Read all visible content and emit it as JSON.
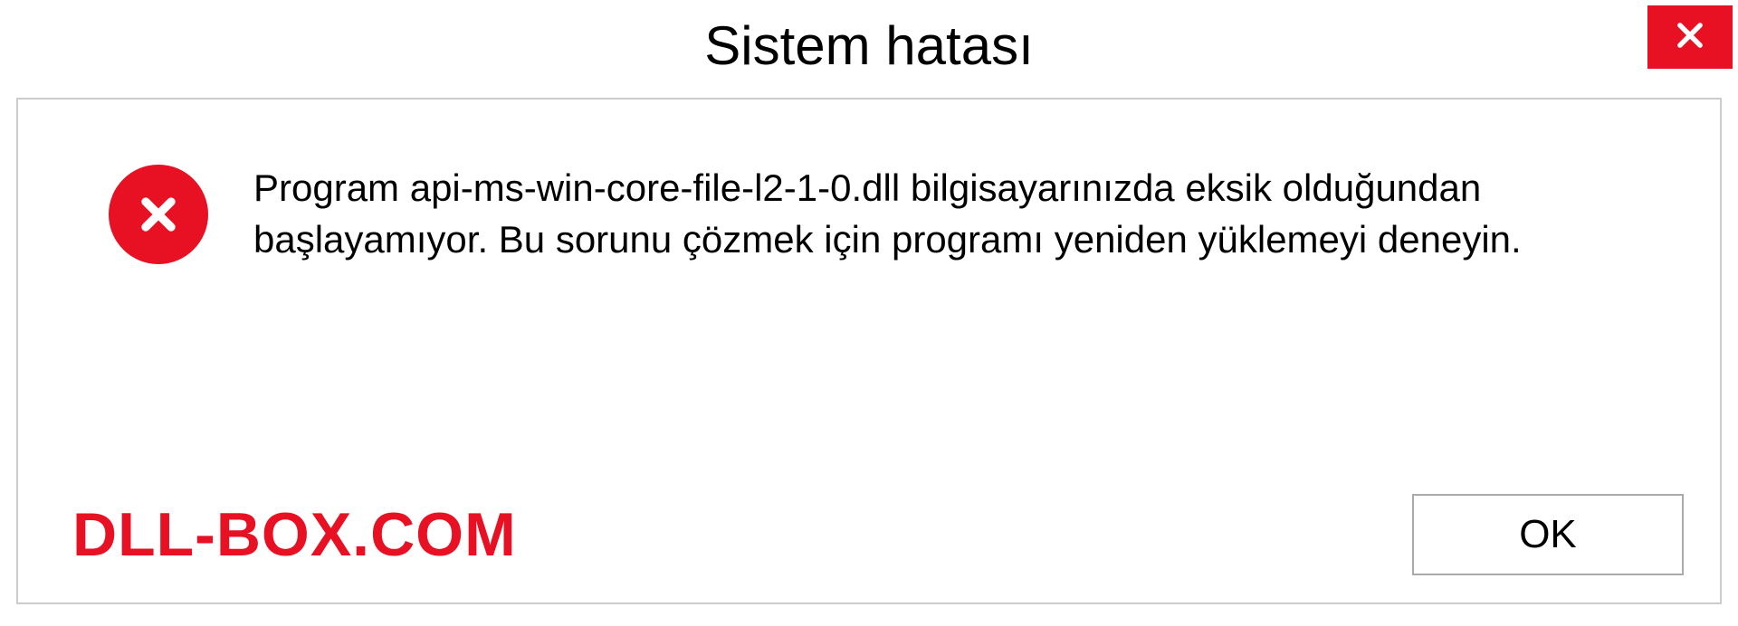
{
  "dialog": {
    "title": "Sistem hatası",
    "message": "Program api-ms-win-core-file-l2-1-0.dll bilgisayarınızda eksik olduğundan başlayamıyor. Bu sorunu çözmek için programı yeniden yüklemeyi deneyin.",
    "ok_label": "OK",
    "watermark": "DLL-BOX.COM"
  }
}
